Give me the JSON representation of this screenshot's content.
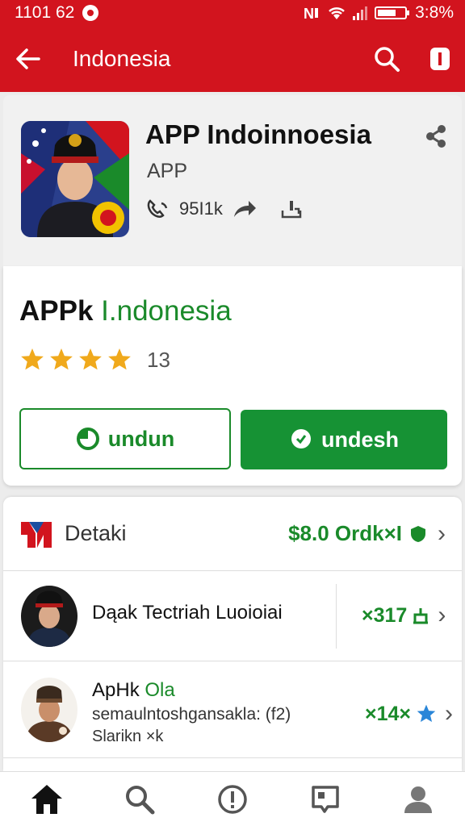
{
  "status_bar": {
    "time": "1101 62",
    "battery": "3:8%"
  },
  "app_bar": {
    "title": "Indonesia",
    "back_icon": "arrow-left-icon",
    "search_icon": "search-icon",
    "menu_icon": "overflow-icon"
  },
  "app_header": {
    "name": "APP Indoinnoesia",
    "subtitle": "APP",
    "meta_count": "95I1k"
  },
  "main": {
    "title_main": "APPk ",
    "title_accent": "I.ndonesia",
    "rating_stars": 4,
    "rating_count": "13",
    "button_outline_label": "undun",
    "button_solid_label": "undesh"
  },
  "details": {
    "header_label": "Detaki",
    "header_value": "$8.0 Ordk×I",
    "rows": [
      {
        "name": "Dąak Tectriah Luoioiai",
        "value": "×317"
      },
      {
        "title_main": "ApHk ",
        "title_accent": "Ola",
        "desc": "semaulntoshgansakla: (f2)",
        "sub": "Slarikn ×k",
        "value": "×14×"
      }
    ]
  },
  "colors": {
    "brand_red": "#d2141e",
    "accent_green": "#1a8a2a",
    "button_green": "#169234",
    "star": "#f0a91c"
  },
  "bottom_nav": {
    "items": [
      "home-icon",
      "search-icon",
      "alert-icon",
      "book-icon",
      "profile-icon"
    ]
  }
}
